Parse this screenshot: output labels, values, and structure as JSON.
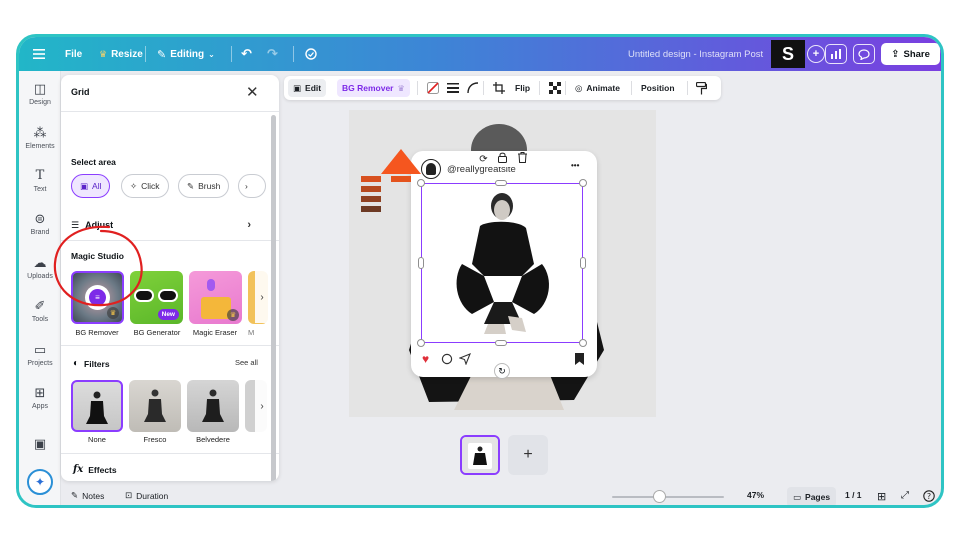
{
  "topbar": {
    "file": "File",
    "resize": "Resize",
    "editing": "Editing",
    "doc_title": "Untitled design - Instagram Post",
    "logo_letter": "S",
    "share": "Share"
  },
  "rail": {
    "items": [
      "Design",
      "Elements",
      "Text",
      "Brand",
      "Uploads",
      "Tools",
      "Projects",
      "Apps"
    ]
  },
  "panel": {
    "title": "Grid",
    "select_area_label": "Select area",
    "chips": [
      "All",
      "Click",
      "Brush"
    ],
    "adjust_label": "Adjust",
    "magic_studio_label": "Magic Studio",
    "magic_tools": [
      "BG Remover",
      "BG Generator",
      "Magic Eraser",
      "M"
    ],
    "new_badge": "New",
    "filters_label": "Filters",
    "see_all": "See all",
    "filters": [
      "None",
      "Fresco",
      "Belvedere"
    ],
    "effects_label": "Effects"
  },
  "context_toolbar": {
    "edit": "Edit",
    "bg_remover": "BG Remover",
    "flip": "Flip",
    "animate": "Animate",
    "position": "Position"
  },
  "post": {
    "handle": "@reallygreatsite",
    "more": "•••"
  },
  "bottombar": {
    "notes": "Notes",
    "duration": "Duration",
    "zoom": "47%",
    "pages": "Pages",
    "page_count": "1 / 1"
  },
  "colors": {
    "accent": "#8b3dff",
    "frame_border": "#2ec4c4",
    "annotation_arrow": "#f5561f",
    "annotation_circle": "#e02020"
  }
}
